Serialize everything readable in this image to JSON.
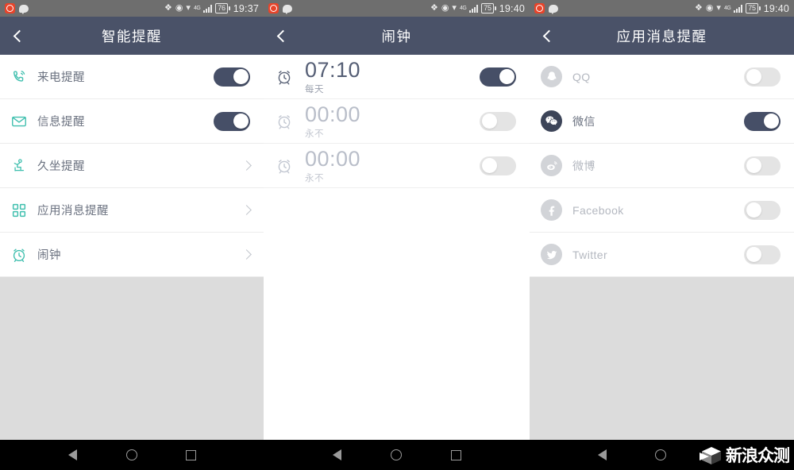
{
  "colors": {
    "header_bg": "#4a5268",
    "statusbar_bg": "#6e6e6e",
    "toggle_on": "#464f67",
    "toggle_off": "#e4e4e4",
    "icon_teal": "#3fbfae",
    "filler_gray": "#dcdcdc",
    "label_gray": "#6b7280",
    "navbar_bg": "#000000"
  },
  "panels": [
    {
      "id": "smart-reminders",
      "statusbar": {
        "time": "19:37",
        "battery": "76",
        "icons": [
          "camera-icon",
          "message-bubble-icon",
          "bluetooth-icon",
          "eye-icon",
          "wifi-icon",
          "signal-4g-icon",
          "battery-icon"
        ],
        "network_label": "4G"
      },
      "header": {
        "title": "智能提醒",
        "back_label": "返回"
      },
      "rows": [
        {
          "icon": "phone-call-icon",
          "label": "来电提醒",
          "control": "toggle",
          "state": "on"
        },
        {
          "icon": "envelope-icon",
          "label": "信息提醒",
          "control": "toggle",
          "state": "on"
        },
        {
          "icon": "sedentary-icon",
          "label": "久坐提醒",
          "control": "chevron"
        },
        {
          "icon": "app-grid-icon",
          "label": "应用消息提醒",
          "control": "chevron"
        },
        {
          "icon": "alarm-clock-icon",
          "label": "闹钟",
          "control": "chevron"
        }
      ]
    },
    {
      "id": "alarm-clock",
      "statusbar": {
        "time": "19:40",
        "battery": "75",
        "icons": [
          "camera-icon",
          "message-bubble-icon",
          "bluetooth-icon",
          "eye-icon",
          "wifi-icon",
          "signal-4g-icon",
          "battery-icon"
        ],
        "network_label": "4G"
      },
      "header": {
        "title": "闹钟",
        "back_label": "返回"
      },
      "alarms": [
        {
          "icon": "alarm-clock-icon",
          "time": "07:10",
          "repeat": "每天",
          "state": "on"
        },
        {
          "icon": "alarm-clock-icon",
          "time": "00:00",
          "repeat": "永不",
          "state": "off"
        },
        {
          "icon": "alarm-clock-icon",
          "time": "00:00",
          "repeat": "永不",
          "state": "off"
        }
      ]
    },
    {
      "id": "app-notifications",
      "statusbar": {
        "time": "19:40",
        "battery": "75",
        "icons": [
          "camera-icon",
          "message-bubble-icon",
          "bluetooth-icon",
          "eye-icon",
          "wifi-icon",
          "signal-4g-icon",
          "battery-icon"
        ],
        "network_label": "4G"
      },
      "header": {
        "title": "应用消息提醒",
        "back_label": "返回"
      },
      "apps": [
        {
          "icon": "qq-icon",
          "label": "QQ",
          "state": "off"
        },
        {
          "icon": "wechat-icon",
          "label": "微信",
          "state": "on"
        },
        {
          "icon": "weibo-icon",
          "label": "微博",
          "state": "off"
        },
        {
          "icon": "facebook-icon",
          "label": "Facebook",
          "state": "off"
        },
        {
          "icon": "twitter-icon",
          "label": "Twitter",
          "state": "off"
        }
      ]
    }
  ],
  "navbar": {
    "buttons": [
      "back-triangle-icon",
      "home-circle-icon",
      "recents-square-icon"
    ]
  },
  "watermark": {
    "text": "新浪众测",
    "logo": "cube-logo-icon"
  }
}
